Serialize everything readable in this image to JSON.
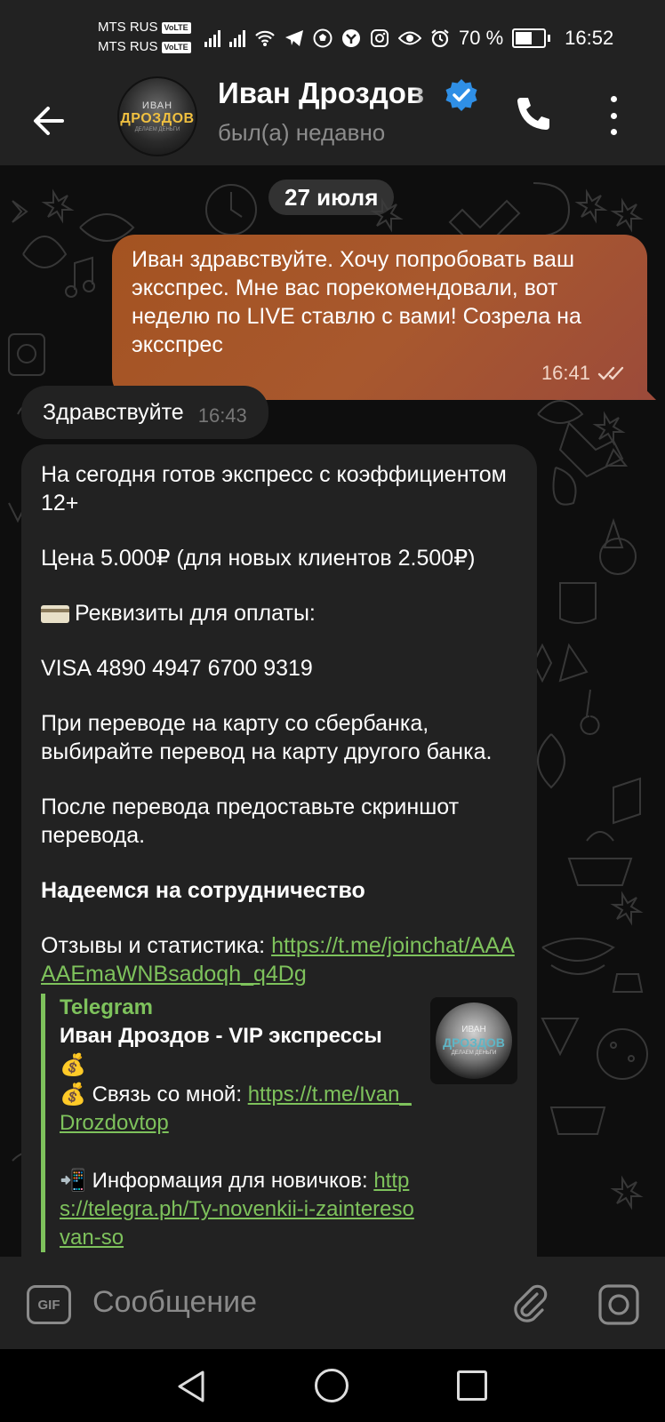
{
  "status_bar": {
    "carrier1": "MTS RUS",
    "carrier2": "MTS RUS",
    "volte": "VoLTE",
    "battery": "70 %",
    "battery_level": 0.7,
    "time": "16:52"
  },
  "header": {
    "contact_name": "Иван Дроздов",
    "status": "был(а) недавно",
    "avatar_text_1": "ИВАН",
    "avatar_text_2": "ДРОЗДОВ",
    "avatar_text_3": "ДЕЛАЕМ ДЕНЬГИ"
  },
  "chat": {
    "date": "27 июля",
    "messages": [
      {
        "direction": "out",
        "text": "Иван здравствуйте. Хочу попробовать ваш эксспрес. Мне вас порекомендовали, вот неделю по LIVE ставлю с вами! Созрела на эксспрес",
        "time": "16:41"
      },
      {
        "direction": "in",
        "text": "Здравствуйте",
        "time": "16:43"
      },
      {
        "direction": "in",
        "paragraphs": {
          "p1": "На сегодня готов экспресс с коэффициентом 12+",
          "p2": "Цена 5.000₽ (для новых клиентов 2.500₽)",
          "p3": "Реквизиты для оплаты:",
          "p4": "VISA 4890 4947 6700 9319",
          "p5": "При переводе на карту со сбербанка, выбирайте перевод на карту другого банка.",
          "p6": "После перевода предоставьте скриншот перевода.",
          "p7": "Надеемся на сотрудничество",
          "p8_label": "Отзывы и статистика: ",
          "p8_link": "https://t.me/joinchat/AAAAAEmaWNBsadoqh_q4Dg"
        },
        "preview": {
          "source": "Telegram",
          "title": "Иван Дроздов - VIP экспрессы",
          "contact_label": "Связь со мной: ",
          "contact_link": "https://t.me/Ivan_Drozdovtop",
          "info_label": "Информация для новичков: ",
          "info_link": "https://telegra.ph/Ty-novenkii-i-zainteresovan-so",
          "thumb_text_1": "ИВАН",
          "thumb_text_2": "ДРОЗДОВ",
          "thumb_text_3": "ДЕЛАЕМ ДЕНЬГИ"
        }
      }
    ]
  },
  "input": {
    "gif_label": "GIF",
    "placeholder": "Сообщение"
  },
  "colors": {
    "outgoing_bubble": "#a8582e",
    "incoming_bubble": "#222222",
    "link": "#7ec25c",
    "verified": "#2f8fe6"
  }
}
